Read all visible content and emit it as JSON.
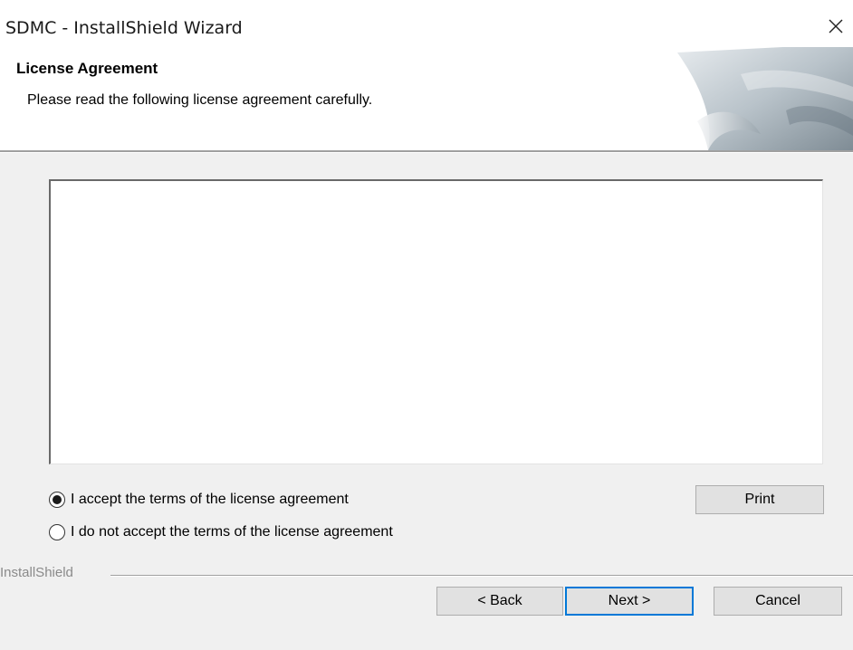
{
  "window": {
    "title": "SDMC - InstallShield Wizard",
    "close_icon": "close-icon"
  },
  "header": {
    "title": "License Agreement",
    "subtitle": "Please read the following license agreement carefully."
  },
  "license_text": "",
  "options": {
    "accept_label": "I accept the terms of the license agreement",
    "decline_label": "I do not accept the terms of the license agreement",
    "selected": "accept"
  },
  "buttons": {
    "print": "Print",
    "back": "< Back",
    "next": "Next >",
    "cancel": "Cancel"
  },
  "branding": {
    "label": "InstallShield"
  },
  "colors": {
    "focus_border": "#0078d7",
    "dialog_bg": "#f0f0f0"
  }
}
